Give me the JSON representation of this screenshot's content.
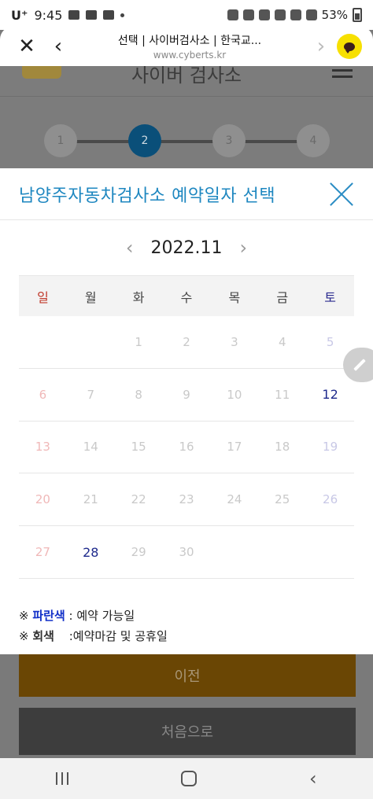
{
  "status_bar": {
    "carrier": "U⁺",
    "time": "9:45",
    "battery": "53%"
  },
  "browser": {
    "title": "선택 | 사이버검사소 | 한국교...",
    "url": "www.cyberts.kr",
    "close_icon": "close-icon",
    "back_icon": "back-arrow-icon",
    "forward_icon": "forward-arrow-icon",
    "kakao_icon": "kakao-talk-icon"
  },
  "background_page": {
    "site_title": "사이버 검사소",
    "steps": [
      "1",
      "2",
      "3",
      "4"
    ],
    "active_step": "2",
    "prev_button": "이전",
    "first_button": "처음으로"
  },
  "modal": {
    "title": "남양주자동차검사소 예약일자 선택",
    "month": "2022.11",
    "weekdays": [
      "일",
      "월",
      "화",
      "수",
      "목",
      "금",
      "토"
    ],
    "weeks": [
      [
        "",
        "",
        "1",
        "2",
        "3",
        "4",
        "5"
      ],
      [
        "6",
        "7",
        "8",
        "9",
        "10",
        "11",
        "12"
      ],
      [
        "13",
        "14",
        "15",
        "16",
        "17",
        "18",
        "19"
      ],
      [
        "20",
        "21",
        "22",
        "23",
        "24",
        "25",
        "26"
      ],
      [
        "27",
        "28",
        "29",
        "30",
        "",
        "",
        ""
      ]
    ],
    "available_days": [
      "12",
      "28"
    ],
    "legend": {
      "blue_marker": "※",
      "blue_label": "파란색",
      "blue_desc": ": 예약 가능일",
      "gray_marker": "※",
      "gray_label": "회색",
      "gray_desc": ":예약마감 및 공휴일"
    }
  },
  "colors": {
    "modal_title": "#1e87c0",
    "available": "#1e2a8c",
    "sunday": "#c0392b",
    "saturday": "#2b2b8f"
  }
}
